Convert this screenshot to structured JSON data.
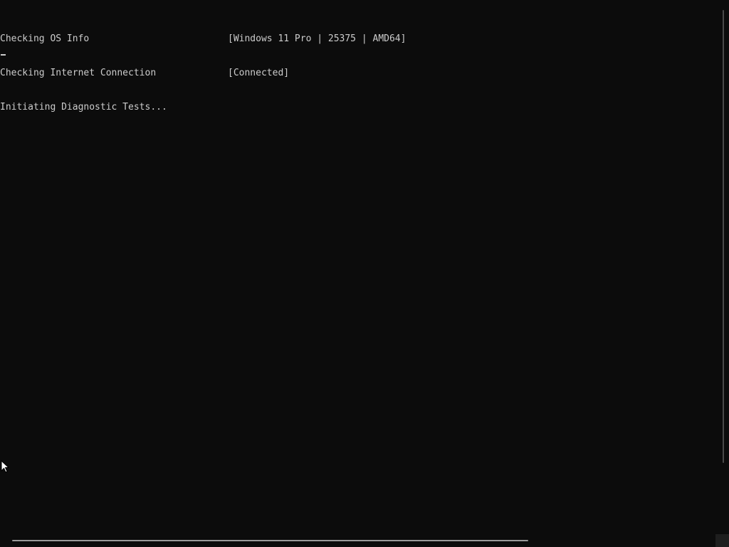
{
  "console": {
    "lines": [
      {
        "label": "Checking OS Info",
        "status": "[Windows 11 Pro | 25375 | AMD64]"
      },
      {
        "label": "Checking Internet Connection",
        "status": "[Connected]"
      },
      {
        "label": "Initiating Diagnostic Tests...",
        "status": ""
      }
    ],
    "text_color": "#cccccc",
    "background_color": "#0c0c0c"
  },
  "icons": {
    "cursor": "text-cursor",
    "pointer": "mouse-pointer-icon"
  }
}
